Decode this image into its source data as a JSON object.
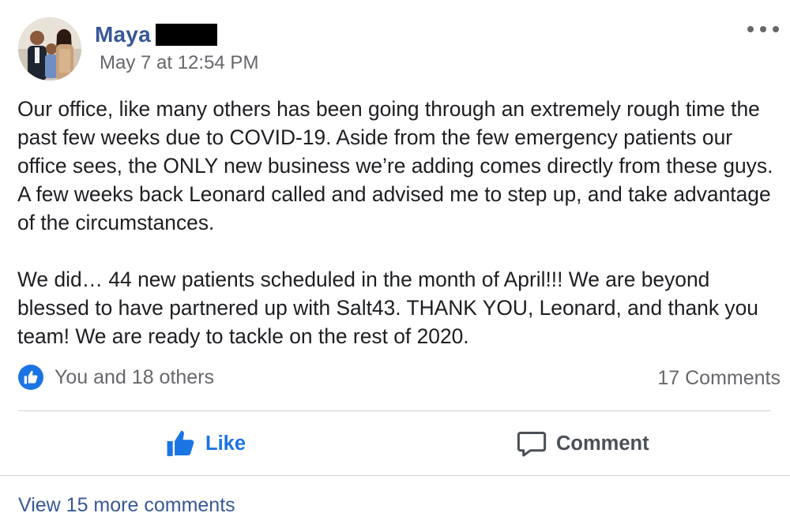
{
  "post": {
    "author_name": "Maya",
    "timestamp": "May 7 at 12:54 PM",
    "body": "Our office, like many others has been going through an extremely rough time the past few weeks due to COVID-19. Aside from the few emergency patients our office sees, the ONLY new business we’re adding comes directly from these guys. A few weeks back Leonard called and advised me to step up, and take advantage of the circumstances.\n\nWe did… 44 new patients scheduled in the month of April!!! We are beyond blessed to have partnered up with Salt43. THANK YOU, Leonard, and thank you team! We are ready to tackle on the rest of 2020."
  },
  "reactions": {
    "icon": "thumbs-up-icon",
    "text": "You and 18 others"
  },
  "comments": {
    "count_label": "17 Comments",
    "view_more_label": "View 15 more comments"
  },
  "actions": {
    "like_label": "Like",
    "comment_label": "Comment"
  },
  "colors": {
    "accent": "#1b74e4",
    "link": "#385898",
    "secondary_text": "#65676b"
  }
}
